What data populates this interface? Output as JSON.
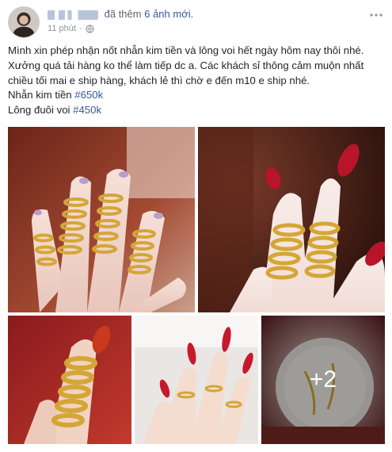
{
  "header": {
    "action_text": "đã thêm",
    "photos_text": "6 ảnh mới.",
    "time": "11 phút",
    "separator": "·",
    "more_icon": "more-options-icon",
    "privacy_icon": "globe-icon"
  },
  "post": {
    "line1": "Mình xin phép nhận nốt nhẫn kim tiền và lông voi hết ngày hôm nay thôi nhé. Xưởng quá tải hàng ko thể làm tiếp dc a. Các khách sỉ thông cảm muộn nhất chiều tối mai e ship hàng, khách lẻ thì chờ e đến m10 e ship nhé.",
    "item1_label": "Nhẫn kim tiền ",
    "item1_price": "#650k",
    "item2_label": "Lông đuôi voi ",
    "item2_price": "#450k"
  },
  "photos": {
    "extra_count": "+2",
    "accent_gold": "#d4a636",
    "nail_red": "#b8142a"
  }
}
